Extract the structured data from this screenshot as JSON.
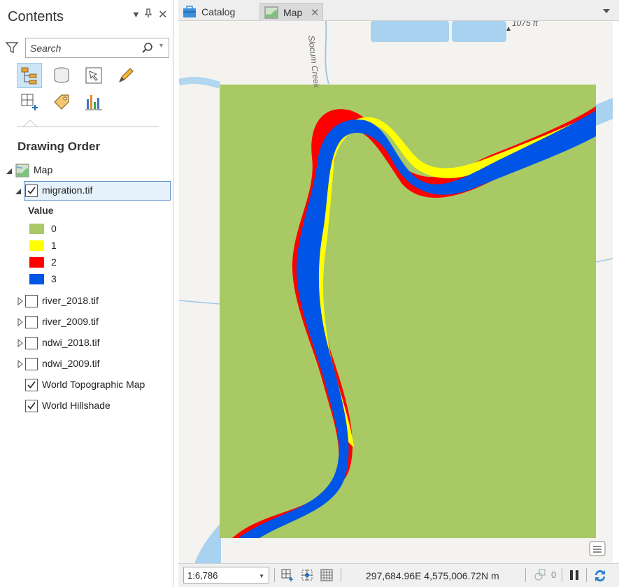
{
  "contents_pane": {
    "title": "Contents",
    "search_placeholder": "Search",
    "section_title": "Drawing Order",
    "icons": {
      "filter": "filter-icon",
      "search": "search-icon",
      "tools": [
        "list-by-drawing-order-icon",
        "list-by-data-source-icon",
        "list-by-selection-icon",
        "list-by-editing-icon",
        "list-by-snapping-icon",
        "list-by-labeling-icon",
        "list-by-charts-icon"
      ]
    },
    "tree": {
      "map": "Map",
      "layers": [
        {
          "name": "migration.tif",
          "checked": true,
          "expanded": true,
          "selected": true
        },
        {
          "name": "river_2018.tif",
          "checked": false,
          "expanded": false
        },
        {
          "name": "river_2009.tif",
          "checked": false,
          "expanded": false
        },
        {
          "name": "ndwi_2018.tif",
          "checked": false,
          "expanded": false
        },
        {
          "name": "ndwi_2009.tif",
          "checked": false,
          "expanded": false
        },
        {
          "name": "World Topographic Map",
          "checked": true
        },
        {
          "name": "World Hillshade",
          "checked": true
        }
      ],
      "legend": {
        "title": "Value",
        "items": [
          {
            "value": "0",
            "color": "#a9c964"
          },
          {
            "value": "1",
            "color": "#ffff00"
          },
          {
            "value": "2",
            "color": "#ff0000"
          },
          {
            "value": "3",
            "color": "#0055e6"
          }
        ]
      }
    }
  },
  "tabs": [
    {
      "label": "Catalog",
      "active": false
    },
    {
      "label": "Map",
      "active": true
    }
  ],
  "map": {
    "labels": {
      "elevation": "1075 ft",
      "creek": "Slocum Creek"
    },
    "colors": {
      "background": "#a9c964",
      "yellow": "#ffff00",
      "red": "#ff0000",
      "blue": "#0055e6",
      "water": "#a8d2f0",
      "basemap": "#f4f3ef"
    }
  },
  "status": {
    "scale": "1:6,786",
    "coordinates": "297,684.96E 4,575,006.72N m",
    "selected_count": "0"
  }
}
